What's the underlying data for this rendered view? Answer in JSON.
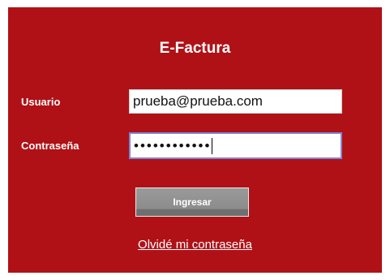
{
  "form": {
    "title": "E-Factura",
    "username_label": "Usuario",
    "username_value": "prueba@prueba.com",
    "password_label": "Contraseña",
    "password_value": "••••••••••••",
    "submit_label": "Ingresar",
    "forgot_label": "Olvidé mi contraseña"
  },
  "colors": {
    "panel_bg": "#b01116",
    "text": "#ffffff",
    "button_bg": "#8c8c8c",
    "focus_border": "#7b86d6"
  }
}
